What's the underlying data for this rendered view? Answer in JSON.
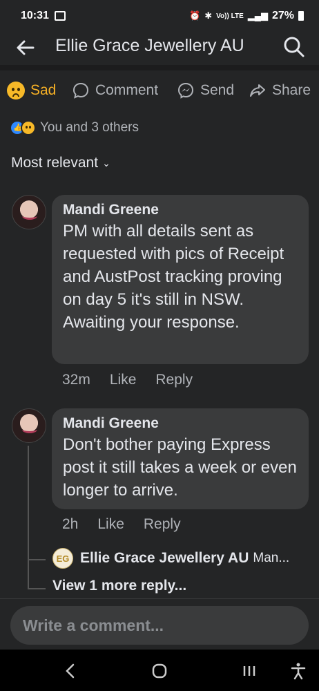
{
  "status_bar": {
    "time": "10:31",
    "network": "Vo)) LTE",
    "battery": "27%"
  },
  "header": {
    "title": "Ellie Grace Jewellery AU"
  },
  "actions": {
    "sad": "Sad",
    "comment": "Comment",
    "send": "Send",
    "share": "Share"
  },
  "reactions": {
    "summary": "You and 3 others"
  },
  "sort": {
    "label": "Most relevant"
  },
  "comments": [
    {
      "author": "Mandi Greene",
      "text": "PM with all details sent as requested with pics of Receipt and AustPost tracking proving on day 5 it's still in NSW.\nAwaiting your response.",
      "time": "32m",
      "like": "Like",
      "reply": "Reply"
    },
    {
      "author": "Mandi Greene",
      "text": "Don't bother paying Express post it still takes a week or even longer to arrive.",
      "time": "2h",
      "like": "Like",
      "reply": "Reply"
    }
  ],
  "reply_preview": {
    "logo": "EG",
    "name": "Ellie Grace Jewellery AU",
    "snippet": "Man..."
  },
  "view_more": "View 1 more reply...",
  "composer": {
    "placeholder": "Write a comment..."
  }
}
